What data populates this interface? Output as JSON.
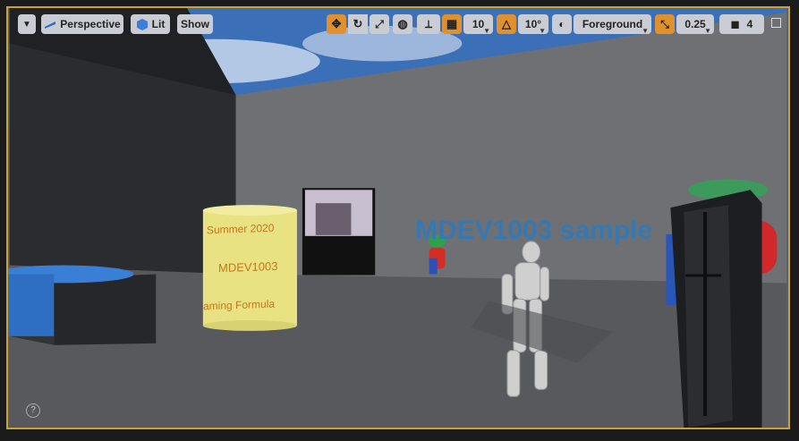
{
  "toolbar": {
    "perspective_label": "Perspective",
    "lit_label": "Lit",
    "show_label": "Show",
    "grid_snap_value": "10",
    "rotation_snap_value": "10°",
    "layer_label": "Foreground",
    "scale_snap_value": "0.25",
    "camera_speed_value": "4"
  },
  "scene": {
    "wall_text": "MDEV1003 sample",
    "can_text_1": "Summer 2020",
    "can_text_2": "MDEV1003",
    "can_text_3": "aming Formula"
  },
  "colors": {
    "active_accent": "#e0902c",
    "viewport_border": "#c9a13a",
    "sky": "#3b6fb8",
    "wall_text": "#2a7bc0"
  }
}
